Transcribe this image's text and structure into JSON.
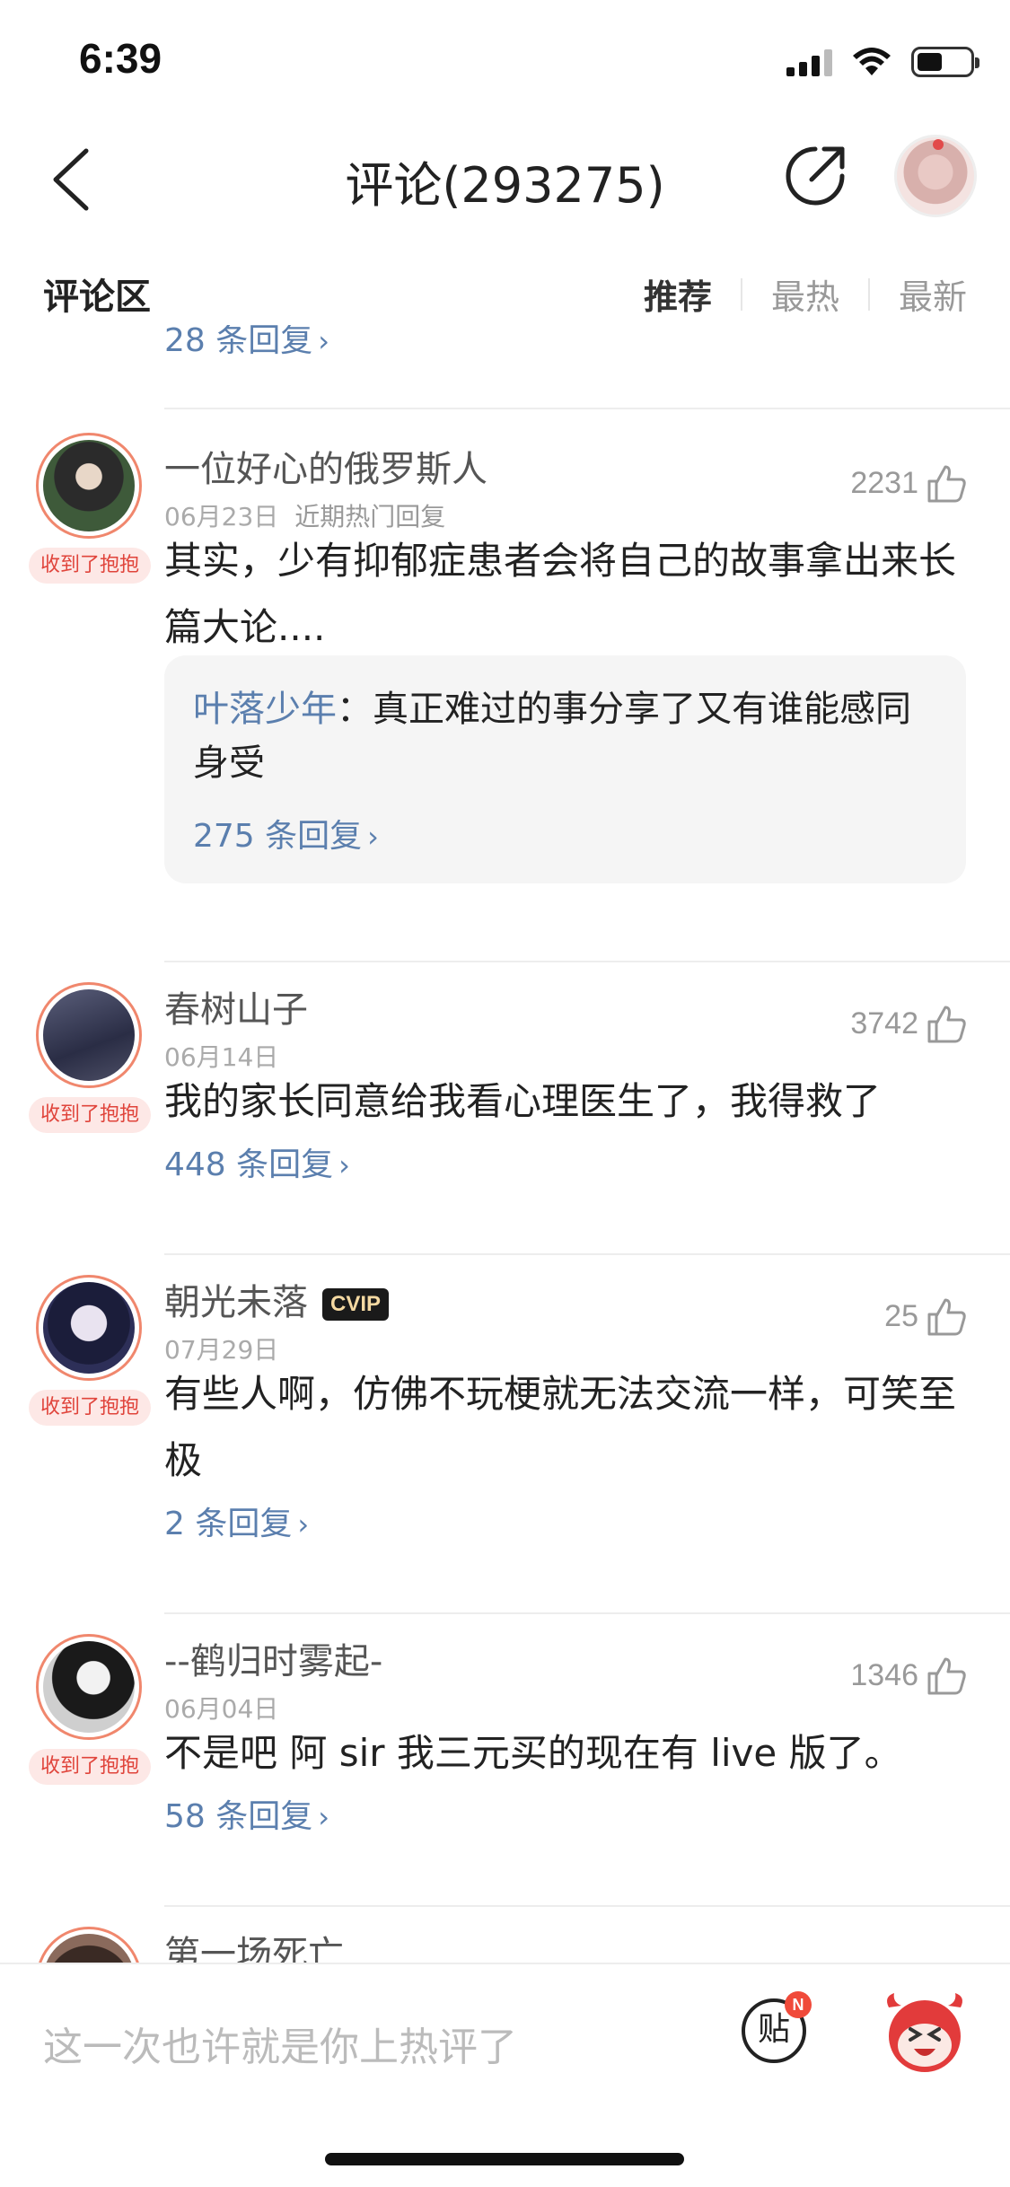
{
  "status_bar": {
    "time": "6:39"
  },
  "header": {
    "title": "评论(293275)"
  },
  "section": {
    "title": "评论区",
    "tabs": [
      "推荐",
      "最热",
      "最新"
    ]
  },
  "top_partial_reply": "28 条回复",
  "comments": [
    {
      "name": "一位好心的俄罗斯人",
      "date": "06月23日",
      "tag": "近期热门回复",
      "likes": "2231",
      "badge": "收到了抱抱",
      "text": "其实，少有抑郁症患者会将自己的故事拿出来长篇大论....",
      "reply": {
        "author": "叶落少年",
        "separator": "：",
        "text": "真正难过的事分享了又有谁能感同身受",
        "more": "275 条回复"
      }
    },
    {
      "name": "春树山子",
      "date": "06月14日",
      "likes": "3742",
      "badge": "收到了抱抱",
      "text": "我的家长同意给我看心理医生了，我得救了",
      "replies": "448 条回复"
    },
    {
      "name": "朝光未落",
      "vip": "CVIP",
      "date": "07月29日",
      "likes": "25",
      "badge": "收到了抱抱",
      "text": "有些人啊，仿佛不玩梗就无法交流一样，可笑至极",
      "replies": "2 条回复"
    },
    {
      "name": "--鹤归时雾起-",
      "date": "06月04日",
      "likes": "1346",
      "badge": "收到了抱抱",
      "text": "不是吧 阿 sir  我三元买的现在有 live 版了。",
      "replies": "58 条回复"
    },
    {
      "name": "第一场死亡"
    }
  ],
  "bottom_bar": {
    "placeholder": "这一次也许就是你上热评了",
    "post_label": "贴",
    "post_badge": "N"
  },
  "colors": {
    "link": "#5b7fae",
    "badge_bg": "#fde8e6",
    "badge_text": "#e0443b",
    "avatar_ring": "#f0876d"
  }
}
